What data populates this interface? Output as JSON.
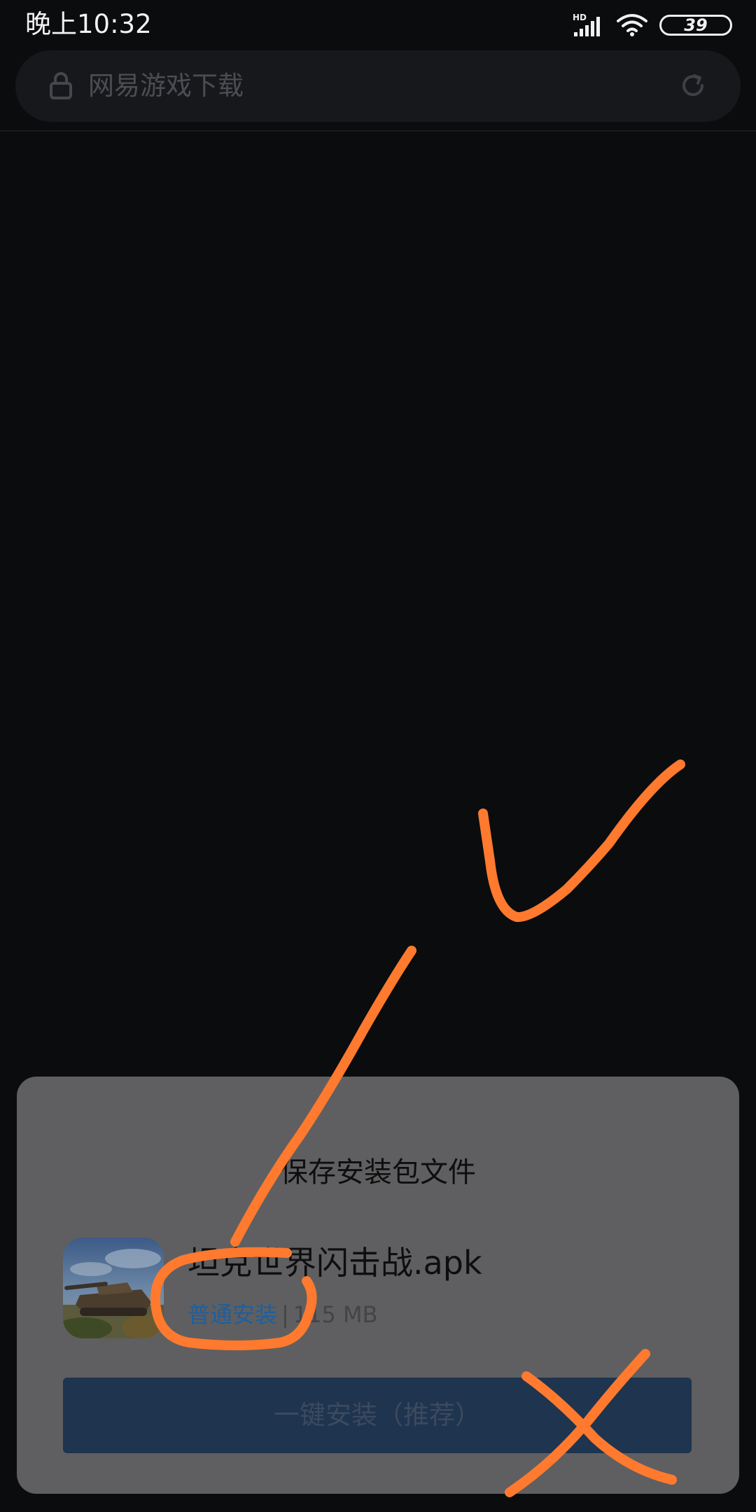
{
  "status_bar": {
    "time": "晚上10:32",
    "network_label": "HD",
    "battery_level": "39",
    "icons": [
      "signal-icon",
      "wifi-icon",
      "battery-icon"
    ]
  },
  "address_bar": {
    "text": "网易游戏下载",
    "icons": [
      "lock-icon",
      "reload-icon"
    ]
  },
  "dialog": {
    "title": "保存安装包文件",
    "file": {
      "name": "坦克世界闪击战.apk",
      "install_mode": "普通安装",
      "separator": "|",
      "size": "115 MB"
    },
    "primary_button": "一键安装（推荐）"
  },
  "colors": {
    "background": "#0b0c0e",
    "sheet": "#5f5f61",
    "link": "#1e5f9e",
    "button": "#1e344f",
    "annotation": "#ff7a2e"
  }
}
